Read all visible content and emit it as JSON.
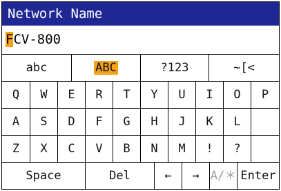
{
  "title": "Network Name",
  "input": {
    "cursor_char": "F",
    "rest": "CV-800"
  },
  "modes": [
    {
      "label": "abc",
      "selected": false
    },
    {
      "label": "ABC",
      "selected": true
    },
    {
      "label": "?123",
      "selected": false
    },
    {
      "label": "~[<",
      "selected": false
    }
  ],
  "rows": [
    [
      "Q",
      "W",
      "E",
      "R",
      "T",
      "Y",
      "U",
      "I",
      "O",
      "P"
    ],
    [
      "A",
      "S",
      "D",
      "F",
      "G",
      "H",
      "J",
      "K",
      "L",
      ""
    ],
    [
      "Z",
      "X",
      "C",
      "V",
      "B",
      "N",
      "M",
      "!",
      "?",
      ""
    ]
  ],
  "bottom": {
    "space": "Space",
    "del": "Del",
    "left": "←",
    "right": "→",
    "alt": "A/＊",
    "enter": "Enter"
  },
  "colors": {
    "title_bg": "#1e2794",
    "highlight": "#f4a11b"
  }
}
